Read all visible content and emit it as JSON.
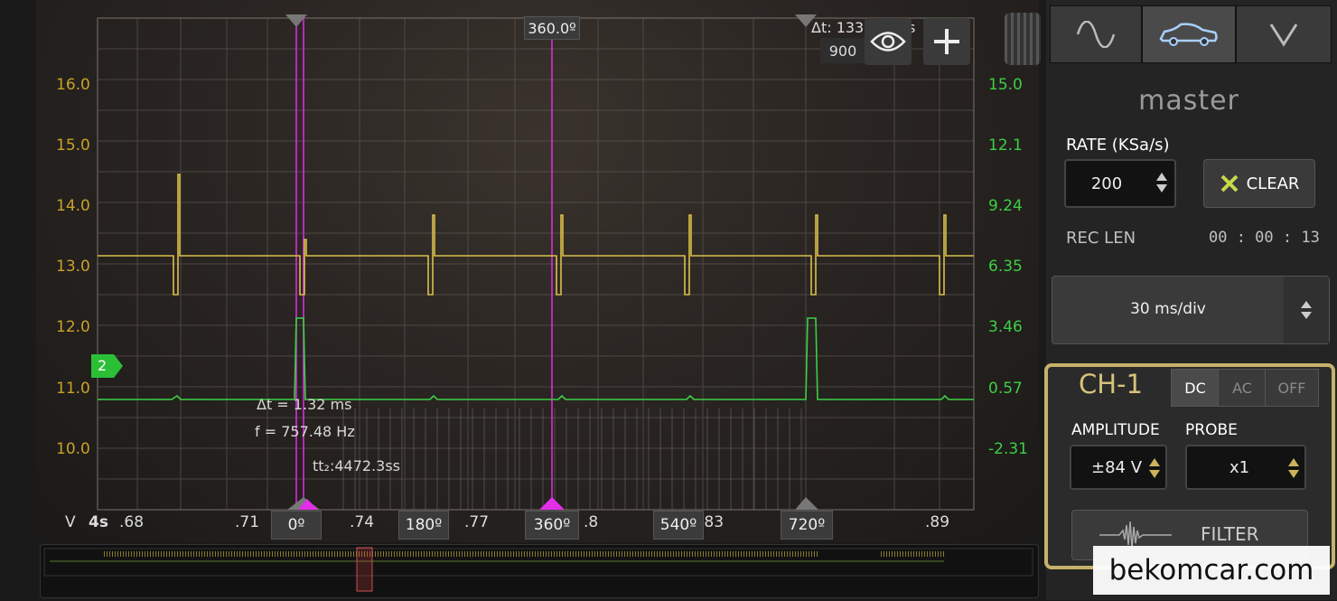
{
  "scope": {
    "y_left_labels": [
      "16.0",
      "15.0",
      "14.0",
      "13.0",
      "12.0",
      "11.0",
      "10.0"
    ],
    "y_right_labels": [
      "15.0",
      "12.1",
      "9.24",
      "6.35",
      "3.46",
      "0.57",
      "-2.31"
    ],
    "x_unit": "V",
    "x_time_unit": "4s",
    "x_labels": [
      ".68",
      ".71",
      ".74",
      ".77",
      ".8",
      ".83",
      ".89"
    ],
    "phase_labels": [
      "0º",
      "180º",
      "360º",
      "540º",
      "720º"
    ],
    "cursor_top_label": "360.0º",
    "delta_t_top": "Δt: 133",
    "delta_t_top_suffix": "s",
    "delta_top_value": "900",
    "channel_marker": "2",
    "measure_dt": "Δt = 1.32 ms",
    "measure_f": "f = 757.48 Hz",
    "measure_t": "tt₂:4472.3ss",
    "colors": {
      "ch1": "#d9c04a",
      "ch2": "#3ccf45",
      "cursor": "#e22ee8"
    }
  },
  "side": {
    "modes": [
      "sine-wave-icon",
      "car-icon",
      "v-icon"
    ],
    "master_title": "master",
    "rate_label": "RATE (KSa/s)",
    "rate_value": "200",
    "clear_label": "CLEAR",
    "rec_len_label": "REC LEN",
    "rec_len_value": "00 : 00 : 13",
    "timebase": "30 ms/div",
    "channel_title": "CH-1",
    "coupling": [
      "DC",
      "AC",
      "OFF"
    ],
    "coupling_selected": "DC",
    "amplitude_label": "AMPLITUDE",
    "probe_label": "PROBE",
    "amplitude_value": "±84 V",
    "probe_value": "x1",
    "filter_label": "FILTER"
  },
  "watermark": "bekomcar.com"
}
